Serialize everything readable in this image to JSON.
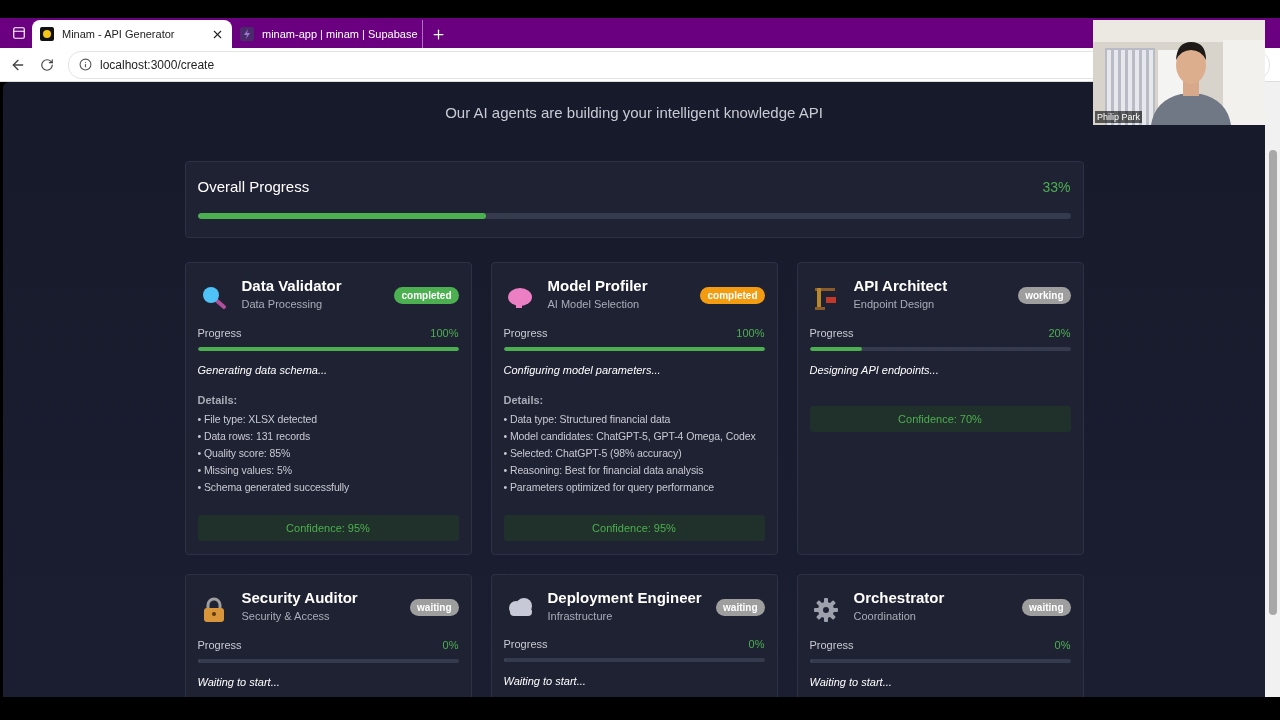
{
  "browser": {
    "tabs": [
      {
        "title": "Minam - API Generator",
        "selected": true
      },
      {
        "title": "minam-app | minam | Supabase",
        "selected": false
      }
    ],
    "address": "localhost:3000/create"
  },
  "webcam": {
    "name": "Philip Park"
  },
  "page": {
    "subtitle": "Our AI agents are building your intelligent knowledge API",
    "overall": {
      "label": "Overall Progress",
      "value": "33%",
      "level": 0.33
    },
    "agents": [
      {
        "name": "Data Validator",
        "role": "Data Processing",
        "status": "completed",
        "color": "#4caf50",
        "progress_label": "Progress",
        "progress_value": "100%",
        "level": 1,
        "activity": "Generating data schema...",
        "details_label": "Details:",
        "details": [
          "• File type: XLSX detected",
          "• Data rows: 131 records",
          "• Quality score: 85%",
          "• Missing values: 5%",
          "• Schema generated successfully"
        ],
        "confidence": "Confidence: 95%"
      },
      {
        "name": "Model Profiler",
        "role": "AI Model Selection",
        "status": "completed",
        "color": "#f39c12",
        "progress_label": "Progress",
        "progress_value": "100%",
        "level": 1,
        "activity": "Configuring model parameters...",
        "details_label": "Details:",
        "details": [
          "• Data type: Structured financial data",
          "• Model candidates: ChatGPT-5, GPT-4 Omega, Codex",
          "• Selected: ChatGPT-5 (98% accuracy)",
          "• Reasoning: Best for financial data analysis",
          "• Parameters optimized for query performance"
        ],
        "confidence": "Confidence: 95%"
      },
      {
        "name": "API Architect",
        "role": "Endpoint Design",
        "status": "working",
        "color": "#9e9e9e",
        "progress_label": "Progress",
        "progress_value": "20%",
        "level": 0.2,
        "activity": "Designing API endpoints...",
        "confidence": "Confidence: 70%"
      },
      {
        "name": "Security Auditor",
        "role": "Security & Access",
        "status": "waiting",
        "color": "#9e9e9e",
        "progress_label": "Progress",
        "progress_value": "0%",
        "level": 0,
        "activity": "Waiting to start..."
      },
      {
        "name": "Deployment Engineer",
        "role": "Infrastructure",
        "status": "waiting",
        "color": "#9e9e9e",
        "progress_label": "Progress",
        "progress_value": "0%",
        "level": 0,
        "activity": "Waiting to start..."
      },
      {
        "name": "Orchestrator",
        "role": "Coordination",
        "status": "waiting",
        "color": "#9e9e9e",
        "progress_label": "Progress",
        "progress_value": "0%",
        "level": 0,
        "activity": "Waiting to start..."
      }
    ]
  }
}
